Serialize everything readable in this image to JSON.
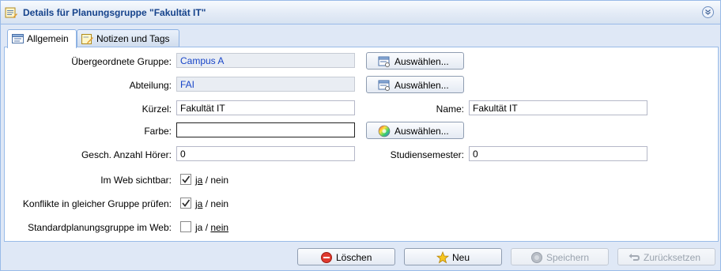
{
  "header": {
    "title": "Details für Planungsgruppe \"Fakultät IT\""
  },
  "tabs": [
    {
      "label": "Allgemein",
      "active": true
    },
    {
      "label": "Notizen und Tags",
      "active": false
    }
  ],
  "form": {
    "parent_group": {
      "label": "Übergeordnete Gruppe:",
      "value": "Campus A",
      "button": "Auswählen..."
    },
    "department": {
      "label": "Abteilung:",
      "value": "FAI",
      "button": "Auswählen..."
    },
    "short_name": {
      "label": "Kürzel:",
      "value": "Fakultät IT"
    },
    "name": {
      "label": "Name:",
      "value": "Fakultät IT"
    },
    "color": {
      "label": "Farbe:",
      "value": "",
      "button": "Auswählen..."
    },
    "listeners": {
      "label": "Gesch. Anzahl Hörer:",
      "value": "0"
    },
    "semester": {
      "label": "Studiensemester:",
      "value": "0"
    },
    "web_visible": {
      "label": "Im Web sichtbar:",
      "checked": true,
      "yes": "ja",
      "sep": "/",
      "no": "nein"
    },
    "conflicts": {
      "label": "Konflikte in gleicher Gruppe prüfen:",
      "checked": true,
      "yes": "ja",
      "sep": "/",
      "no": "nein"
    },
    "default_web": {
      "label": "Standardplanungsgruppe im Web:",
      "checked": false,
      "yes": "ja",
      "sep": "/",
      "no": "nein"
    }
  },
  "footer": {
    "delete": "Löschen",
    "new": "Neu",
    "save": "Speichern",
    "reset": "Zurücksetzen"
  },
  "colors": {
    "header_text": "#15428b",
    "readonly_text": "#1845c8",
    "panel_border": "#99bbe8"
  }
}
